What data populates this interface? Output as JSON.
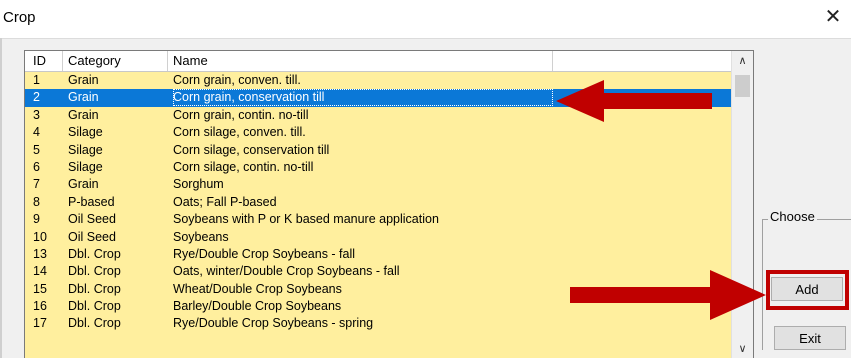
{
  "window": {
    "title": "Crop",
    "close_glyph": "✕"
  },
  "columns": [
    "ID",
    "Category",
    "Name"
  ],
  "rows": [
    {
      "id": "1",
      "category": "Grain",
      "name": "Corn grain, conven. till."
    },
    {
      "id": "2",
      "category": "Grain",
      "name": "Corn grain, conservation till"
    },
    {
      "id": "3",
      "category": "Grain",
      "name": "Corn grain, contin. no-till"
    },
    {
      "id": "4",
      "category": "Silage",
      "name": "Corn silage, conven. till."
    },
    {
      "id": "5",
      "category": "Silage",
      "name": "Corn silage, conservation till"
    },
    {
      "id": "6",
      "category": "Silage",
      "name": "Corn silage, contin. no-till"
    },
    {
      "id": "7",
      "category": "Grain",
      "name": "Sorghum"
    },
    {
      "id": "8",
      "category": "P-based",
      "name": "Oats; Fall P-based"
    },
    {
      "id": "9",
      "category": "Oil Seed",
      "name": "Soybeans with P or K based manure application"
    },
    {
      "id": "10",
      "category": "Oil Seed",
      "name": "Soybeans"
    },
    {
      "id": "13",
      "category": "Dbl. Crop",
      "name": "Rye/Double Crop Soybeans - fall"
    },
    {
      "id": "14",
      "category": "Dbl. Crop",
      "name": "Oats, winter/Double Crop Soybeans - fall"
    },
    {
      "id": "15",
      "category": "Dbl. Crop",
      "name": "Wheat/Double Crop Soybeans"
    },
    {
      "id": "16",
      "category": "Dbl. Crop",
      "name": "Barley/Double Crop Soybeans"
    },
    {
      "id": "17",
      "category": "Dbl. Crop",
      "name": "Rye/Double Crop Soybeans - spring"
    }
  ],
  "selected_row_id": "2",
  "scroll": {
    "up_glyph": "∧",
    "down_glyph": "∨"
  },
  "choose_group": {
    "label": "Choose"
  },
  "buttons": {
    "add": "Add",
    "exit": "Exit"
  },
  "colors": {
    "list_bg": "#ffef9e",
    "selection": "#0b78d7",
    "annotation": "#c00000"
  }
}
